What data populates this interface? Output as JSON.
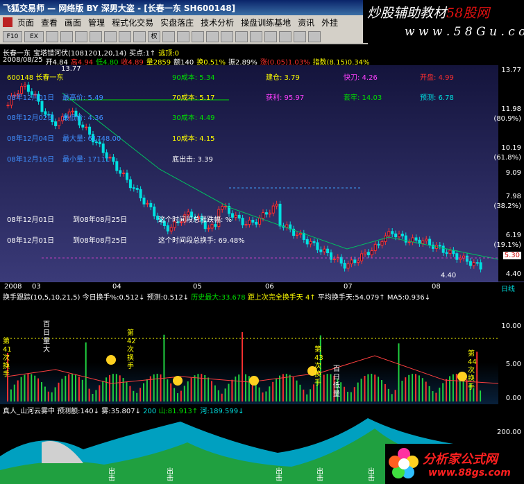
{
  "window": {
    "title": "飞狐交易师 — 网络版 BY 深男大盗 - [长春一东 SH600148]"
  },
  "watermark": {
    "line1_a": "炒股辅助教材",
    "line1_b": "58股网",
    "line2": "w w w . 5 8 G u . c o m"
  },
  "menu": [
    "页面",
    "查看",
    "画面",
    "管理",
    "程式化交易",
    "实盘落庄",
    "技术分析",
    "操盘训练基地",
    "资讯",
    "外挂"
  ],
  "toolbar": [
    "F10",
    "EX",
    "",
    "",
    "",
    "",
    "",
    "",
    "",
    "权",
    "",
    "",
    "",
    "",
    "",
    "",
    "",
    "",
    "",
    "",
    ""
  ],
  "info1": {
    "name": "长春一东",
    "formula": "宝塔错河伏(1081201,20,14)",
    "buy": "买点:1↑",
    "escape": "逃顶:0"
  },
  "info2": {
    "date": "2008/08/25",
    "open": "开4.84",
    "high": "高4.94",
    "low": "低4.80",
    "close": "收4.89",
    "vol": "量2859",
    "amt": "额140",
    "turn": "换0.51%",
    "amp": "振2.89%",
    "chg": "涨(0.05)1.03%",
    "idx": "指数(8.15)0.34%"
  },
  "overlay": {
    "code": "600148 长春一东",
    "r1": [
      "08年12月01日",
      "最高价: 5.49"
    ],
    "r2": [
      "08年12月02日",
      "最低价: 4.36"
    ],
    "r3": [
      "08年12月04日",
      "最大量: 61748.00"
    ],
    "r4": [
      "08年12月16日",
      "最小量: 17111"
    ],
    "c90": "90成本: 5.34",
    "c70": "70成本: 5.17",
    "c30": "30成本: 4.49",
    "c10": "10成本: 4.15",
    "bottom": "底出击: 3.39",
    "jc": "建仓: 3.79",
    "kd": "快刀: 4.26",
    "kp": "开盘: 4.99",
    "hl": "获利: 95.97",
    "tl": "套牢: 14.03",
    "yc": "预测: 6.78",
    "range1": [
      "08年12月01日",
      "到08年08月25日",
      "这个时间段总涨跌幅: %"
    ],
    "range2": [
      "08年12月01日",
      "到08年08月25日",
      "这个时间段总换手: 69.48%"
    ],
    "hi_label": "13.77",
    "lo_label": "4.40"
  },
  "yaxis": [
    "13.77",
    "11.98",
    "(80.9%)",
    "10.19",
    "(61.8%)",
    "9.09",
    "7.98",
    "(38.2%)",
    "6.19",
    "(19.1%)",
    "5.30",
    "4.40"
  ],
  "dates": [
    "2008",
    "03",
    "04",
    "05",
    "06",
    "07",
    "08"
  ],
  "dateaxis_label": "日线",
  "panel2": {
    "title": "换手跟踪(10,5,10,21,5)",
    "today": "今日换手%:0.512↓",
    "pred": "预测:0.512↓",
    "hist": "历史最大:33.678",
    "since": "距上次完全换手天 4↑",
    "avg": "平均换手天:54.079↑",
    "ma5": "MA5:0.936↓",
    "yaxis": [
      "10.00",
      "5.00",
      "0.00"
    ],
    "labels": [
      "第41次换手",
      "百日量大",
      "第42次换手",
      "第43次换手",
      "第44次换手",
      "百日低量"
    ]
  },
  "panel3": {
    "title": "真人_山河云雾中",
    "pred": "预测额:140↓",
    "fog": "雾:35.807↓",
    "m200": "200",
    "mountain": "山:81.913↑",
    "river": "河:189.599↓",
    "yaxis": [
      "200.00"
    ],
    "marks": [
      "出击",
      "出击",
      "出击",
      "出击",
      "出击"
    ]
  },
  "logo2": {
    "l1": "分析家公式网",
    "l2": "www.88gs.com"
  },
  "colors": {
    "bg_main": "#14143c",
    "up": "#ff3030",
    "down": "#00e0e0"
  }
}
